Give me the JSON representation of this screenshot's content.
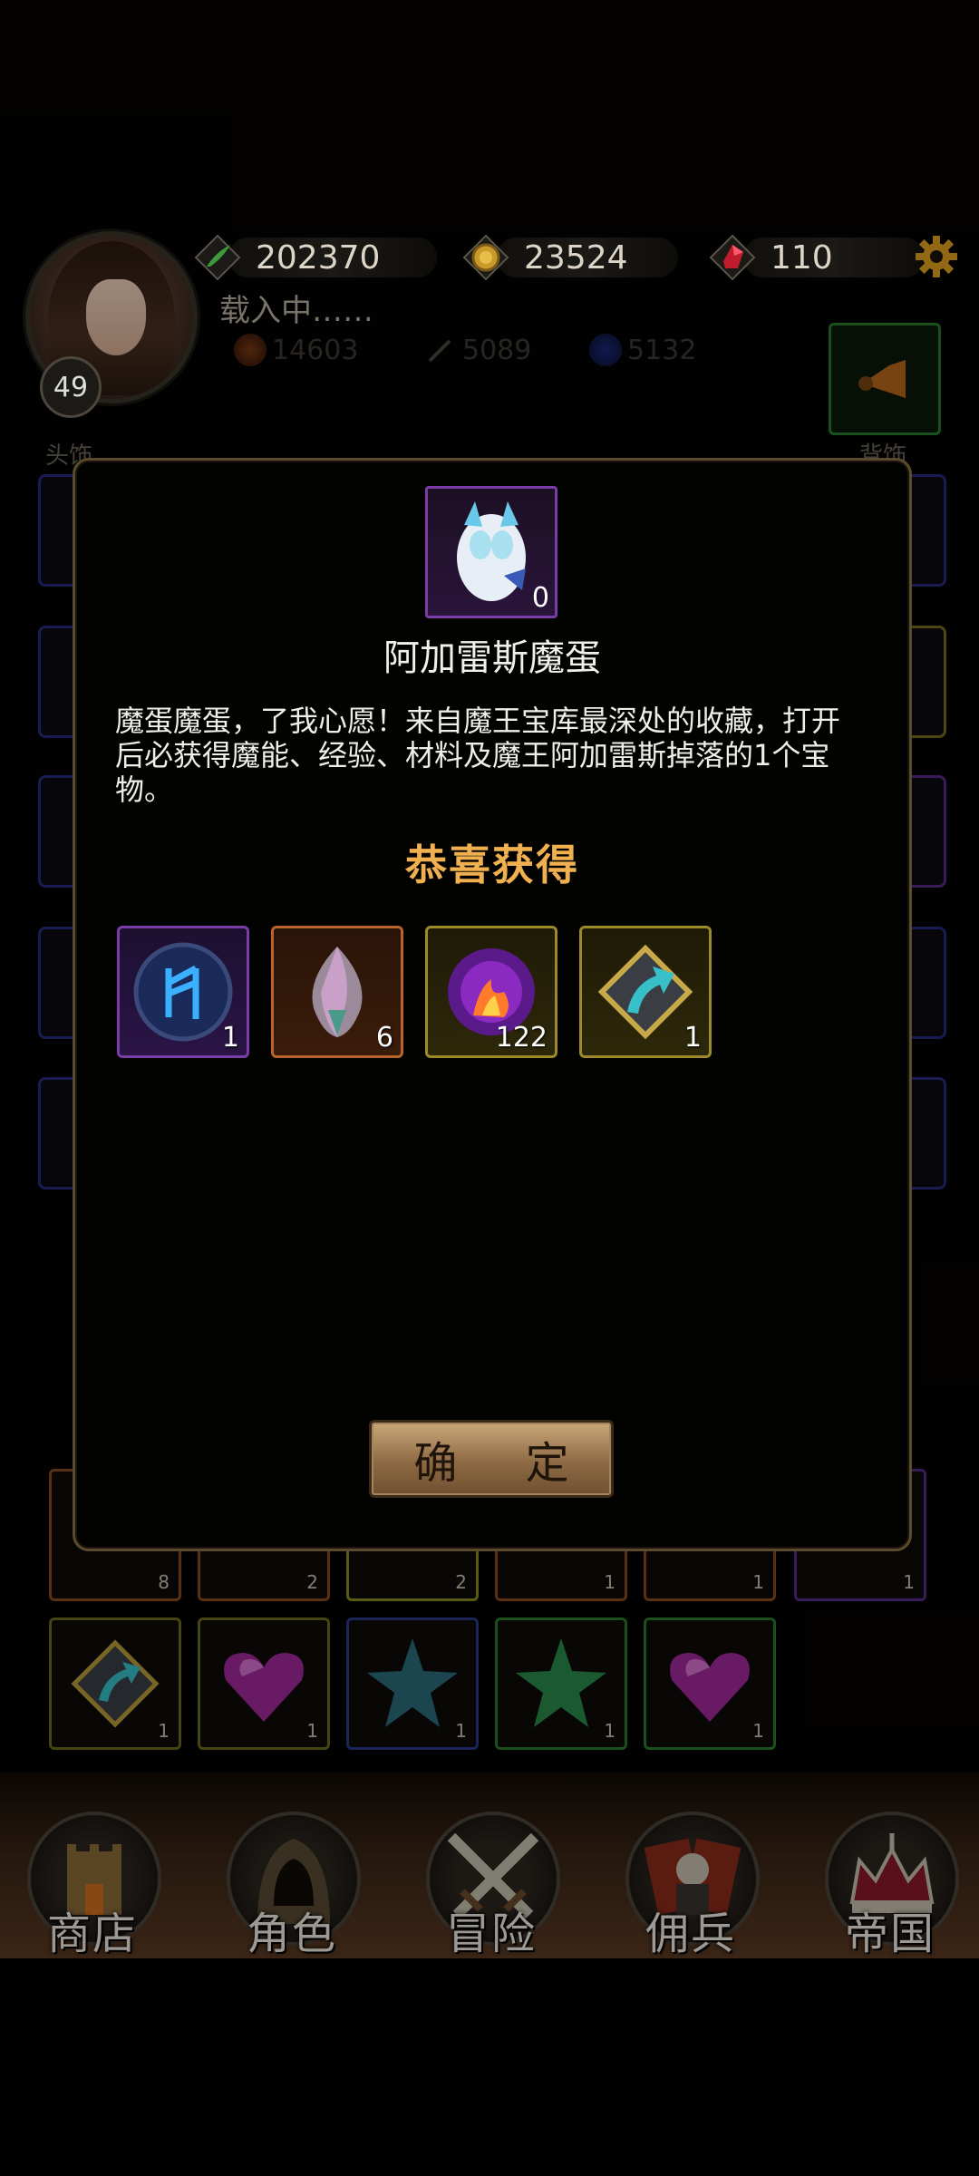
{
  "header": {
    "player_level": "49",
    "loading_text": "载入中……",
    "currencies": [
      {
        "icon": "green-feather-icon",
        "value": "202370"
      },
      {
        "icon": "gold-coin-icon",
        "value": "23524"
      },
      {
        "icon": "red-gem-icon",
        "value": "110"
      }
    ],
    "substats": [
      {
        "icon": "orange-orb-icon",
        "value": "14603"
      },
      {
        "icon": "sword-icon",
        "value": "5089"
      },
      {
        "icon": "blue-orb-icon",
        "value": "5132"
      }
    ]
  },
  "slots": {
    "left_label": "头饰",
    "right_label": "背饰"
  },
  "modal": {
    "item_name": "阿加雷斯魔蛋",
    "item_count": "0",
    "description": "魔蛋魔蛋，了我心愿！来自魔王宝库最深处的收藏，打开后必获得魔能、经验、材料及魔王阿加雷斯掉落的1个宝物。",
    "congrats": "恭喜获得",
    "rewards": [
      {
        "icon": "blue-rune-icon",
        "count": "1",
        "frame": "purple"
      },
      {
        "icon": "pink-crystal-icon",
        "count": "6",
        "frame": "orange"
      },
      {
        "icon": "purple-flame-orb-icon",
        "count": "122",
        "frame": "yellow"
      },
      {
        "icon": "upgrade-arrow-icon",
        "count": "1",
        "frame": "yellow"
      }
    ],
    "confirm_label": "确 定"
  },
  "inventory": {
    "row1_counts": [
      "8",
      "2",
      "2",
      "1",
      "1",
      "1"
    ],
    "row2": [
      {
        "icon": "upgrade-arrow-icon",
        "count": "1"
      },
      {
        "icon": "purple-heart-gem-icon",
        "count": "1"
      },
      {
        "icon": "blue-star-icon",
        "count": "1"
      },
      {
        "icon": "green-star-icon",
        "count": "1"
      },
      {
        "icon": "purple-heart-gem-icon",
        "count": "1"
      }
    ]
  },
  "nav": {
    "items": [
      {
        "label": "商店",
        "icon": "castle-icon"
      },
      {
        "label": "角色",
        "icon": "hood-icon"
      },
      {
        "label": "冒险",
        "icon": "crossed-swords-icon"
      },
      {
        "label": "佣兵",
        "icon": "cards-icon"
      },
      {
        "label": "帝国",
        "icon": "crown-icon"
      }
    ]
  },
  "colors": {
    "accent_gold": "#f0b050",
    "frame_purple": "#7a3ca8",
    "frame_orange": "#b8642a",
    "frame_yellow": "#9c8a28"
  }
}
